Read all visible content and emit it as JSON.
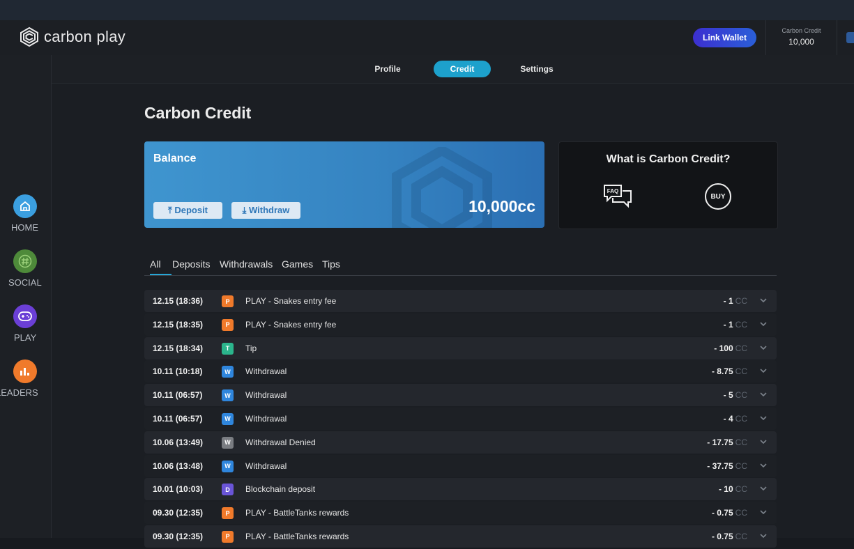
{
  "header": {
    "logo_text": "carbon play",
    "link_wallet_label": "Link Wallet",
    "credit_label": "Carbon Credit",
    "credit_value": "10,000"
  },
  "subnav": {
    "tabs": [
      {
        "label": "Profile",
        "active": false
      },
      {
        "label": "Credit",
        "active": true
      },
      {
        "label": "Settings",
        "active": false
      }
    ]
  },
  "sidebar": {
    "items": [
      {
        "label": "HOME",
        "icon": "home-icon",
        "color": "#3b9fe0"
      },
      {
        "label": "SOCIAL",
        "icon": "hashtag-icon",
        "color": "#4e8a3a"
      },
      {
        "label": "PLAY",
        "icon": "gamepad-icon",
        "color": "#6b3fd6"
      },
      {
        "label": "LEADERS",
        "icon": "bar-chart-icon",
        "color": "#f07a2b"
      }
    ]
  },
  "main": {
    "title": "Carbon Credit",
    "balance": {
      "label": "Balance",
      "amount": "10,000cc",
      "deposit_label": "⤒ Deposit",
      "withdraw_label": "⤓ Withdraw"
    },
    "info": {
      "title": "What is Carbon Credit?",
      "faq_label": "FAQ",
      "buy_label": "BUY"
    },
    "filters": [
      "All",
      "Deposits",
      "Withdrawals",
      "Games",
      "Tips"
    ],
    "active_filter": "All"
  },
  "transactions": [
    {
      "date": "12.15 (18:36)",
      "badge": "P",
      "badge_color": "#f07a2b",
      "desc": "PLAY - Snakes entry fee",
      "amount": "- 1",
      "unit": "CC"
    },
    {
      "date": "12.15 (18:35)",
      "badge": "P",
      "badge_color": "#f07a2b",
      "desc": "PLAY - Snakes entry fee",
      "amount": "- 1",
      "unit": "CC"
    },
    {
      "date": "12.15 (18:34)",
      "badge": "T",
      "badge_color": "#2bb58c",
      "desc": "Tip",
      "amount": "- 100",
      "unit": "CC"
    },
    {
      "date": "10.11 (10:18)",
      "badge": "W",
      "badge_color": "#2f86dd",
      "desc": "Withdrawal",
      "amount": "- 8.75",
      "unit": "CC"
    },
    {
      "date": "10.11 (06:57)",
      "badge": "W",
      "badge_color": "#2f86dd",
      "desc": "Withdrawal",
      "amount": "- 5",
      "unit": "CC"
    },
    {
      "date": "10.11 (06:57)",
      "badge": "W",
      "badge_color": "#2f86dd",
      "desc": "Withdrawal",
      "amount": "- 4",
      "unit": "CC"
    },
    {
      "date": "10.06 (13:49)",
      "badge": "W",
      "badge_color": "#7a7d82",
      "desc": "Withdrawal Denied",
      "amount": "- 17.75",
      "unit": "CC"
    },
    {
      "date": "10.06 (13:48)",
      "badge": "W",
      "badge_color": "#2f86dd",
      "desc": "Withdrawal",
      "amount": "- 37.75",
      "unit": "CC"
    },
    {
      "date": "10.01 (10:03)",
      "badge": "D",
      "badge_color": "#6a55d8",
      "desc": "Blockchain deposit",
      "amount": "- 10",
      "unit": "CC"
    },
    {
      "date": "09.30 (12:35)",
      "badge": "P",
      "badge_color": "#f07a2b",
      "desc": "PLAY - BattleTanks rewards",
      "amount": "- 0.75",
      "unit": "CC"
    },
    {
      "date": "09.30 (12:35)",
      "badge": "P",
      "badge_color": "#f07a2b",
      "desc": "PLAY - BattleTanks rewards",
      "amount": "- 0.75",
      "unit": "CC"
    }
  ]
}
